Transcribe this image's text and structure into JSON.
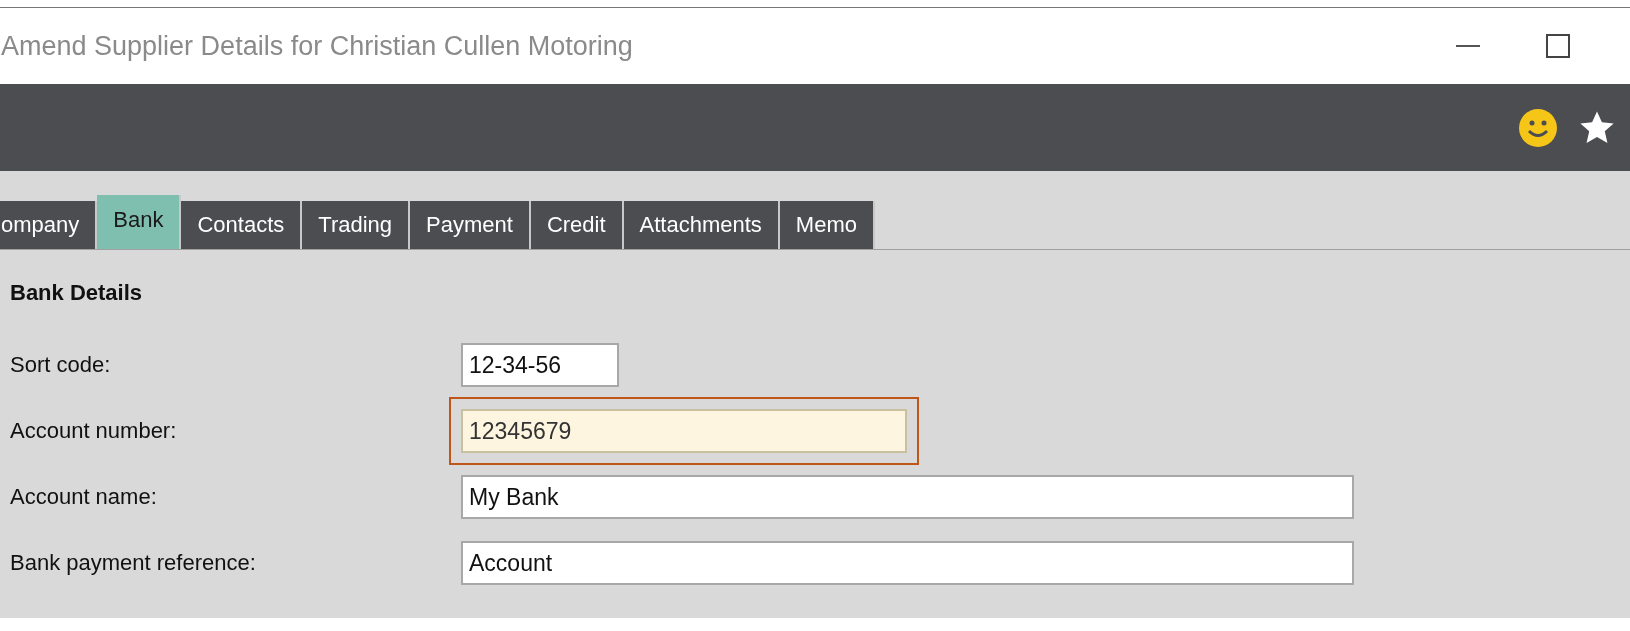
{
  "window": {
    "title": "Amend Supplier Details for Christian Cullen Motoring"
  },
  "tabs": [
    {
      "label": "ompany",
      "selected": false
    },
    {
      "label": "Bank",
      "selected": true
    },
    {
      "label": "Contacts",
      "selected": false
    },
    {
      "label": "Trading",
      "selected": false
    },
    {
      "label": "Payment",
      "selected": false
    },
    {
      "label": "Credit",
      "selected": false
    },
    {
      "label": "Attachments",
      "selected": false
    },
    {
      "label": "Memo",
      "selected": false
    }
  ],
  "section": {
    "title": "Bank Details"
  },
  "fields": [
    {
      "label": "Sort code:",
      "value": "12-34-56",
      "focused": false
    },
    {
      "label": "Account number:",
      "value": "12345679",
      "focused": true
    },
    {
      "label": "Account name:",
      "value": "My Bank",
      "focused": false
    },
    {
      "label": "Bank payment reference:",
      "value": "Account",
      "focused": false
    }
  ]
}
